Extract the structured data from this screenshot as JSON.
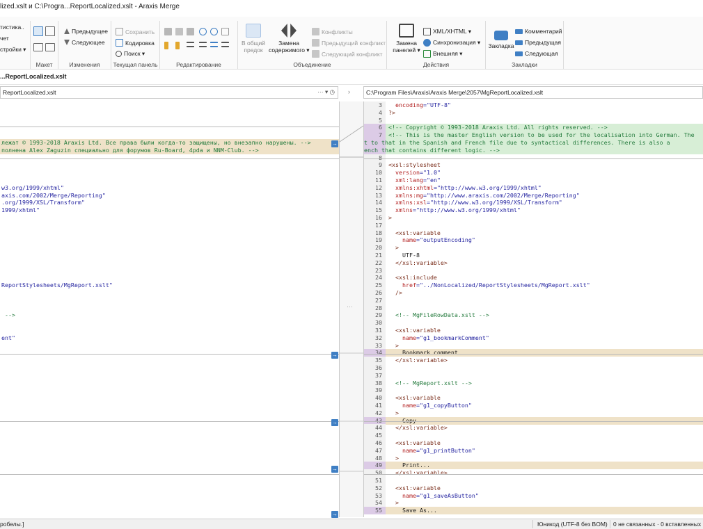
{
  "window": {
    "title": "lized.xslt и C:\\Progra...ReportLocalized.xslt - Araxis Merge"
  },
  "ribbon": {
    "stats": [
      "тистика..",
      "чет",
      "стройки ▾"
    ],
    "layout": {
      "label": "Макет"
    },
    "changes": {
      "prev": "Предыдущее",
      "next": "Следующее",
      "label": "Изменения"
    },
    "current_panel": {
      "save": "Сохранить",
      "encoding": "Кодировка",
      "search": "Поиск ▾",
      "label": "Текущая панель"
    },
    "editing": {
      "label": "Редактирование"
    },
    "merge": {
      "general_view": "В общий\nпредок",
      "replace": "Замена\nсодержимого ▾",
      "conflicts": "Конфликты",
      "prev_conflict": "Предыдущий конфликт",
      "next_conflict": "Следующий конфликт",
      "label": "Объединение"
    },
    "actions": {
      "replace_panels": "Замена\nпанелей ▾",
      "xml": "XML/XHTML ▾",
      "sync": "Синхронизация ▾",
      "external": "Внешняя ▾",
      "label": "Действия"
    },
    "bookmarks": {
      "bookmark": "Закладка",
      "comment": "Комментарий",
      "prev": "Предыдущая",
      "next": "Следующая",
      "label": "Закладки"
    }
  },
  "doc_tab": {
    "label": "...ReportLocalized.xslt"
  },
  "path_left": {
    "text": "ReportLocalized.xslt",
    "tools": "··· ▾ ◷"
  },
  "path_right": {
    "text": "C:\\Program Files\\Araxis\\Araxis Merge\\2057\\MgReportLocalized.xslt"
  },
  "left_lines": [
    {
      "row": 5,
      "text": "лежат © 1993-2018 Araxis Ltd. Все права были когда-то защищены, но внезапно нарушены. -->",
      "cls": "cmt",
      "bg": "chg"
    },
    {
      "row": 6,
      "text": "полнена Alex Zaguzin специально для форумов Ru-Board, 4pda и NNM-Club. -->",
      "cls": "cmt",
      "bg": "chg"
    },
    {
      "row": 11,
      "text": "w3.org/1999/xhtml\"",
      "cls": "val",
      "bg": ""
    },
    {
      "row": 12,
      "text": "axis.com/2002/Merge/Reporting\"",
      "cls": "val",
      "bg": ""
    },
    {
      "row": 13,
      "text": ".org/1999/XSL/Transform\"",
      "cls": "val",
      "bg": ""
    },
    {
      "row": 14,
      "text": "1999/xhtml\"",
      "cls": "val",
      "bg": ""
    },
    {
      "row": 24,
      "text": "ReportStylesheets/MgReport.xslt\"",
      "cls": "val",
      "bg": ""
    },
    {
      "row": 28,
      "text": " -->",
      "cls": "cmt",
      "bg": ""
    },
    {
      "row": 31,
      "text": "ent\"",
      "cls": "val",
      "bg": ""
    }
  ],
  "right_lines": [
    {
      "n": "3",
      "parts": [
        {
          "t": "  ",
          "c": ""
        },
        {
          "t": "encoding",
          "c": "attr"
        },
        {
          "t": "=\"UTF-8\"",
          "c": "val"
        }
      ],
      "bg": ""
    },
    {
      "n": "4",
      "parts": [
        {
          "t": "?>",
          "c": "tag"
        }
      ],
      "bg": ""
    },
    {
      "n": "5",
      "parts": [],
      "bg": ""
    },
    {
      "n": "6",
      "parts": [
        {
          "t": "<!-- Copyright © 1993-2018 Araxis Ltd. All rights reserved. -->",
          "c": "cmt"
        }
      ],
      "bg": "ins"
    },
    {
      "n": "7",
      "parts": [
        {
          "t": "<!-- This is the master English version to be used for the localisation into German. The",
          "c": "cmt"
        }
      ],
      "bg": "ins"
    },
    {
      "n": "",
      "parts": [
        {
          "t": "t to that in the Spanish and French file due to syntactical differences. There is also a",
          "c": "cmt"
        }
      ],
      "bg": "ins",
      "lc": true
    },
    {
      "n": "",
      "parts": [
        {
          "t": "ench that contains different logic. -->",
          "c": "cmt"
        }
      ],
      "bg": "ins",
      "lc": true
    },
    {
      "n": "8",
      "parts": [],
      "bg": ""
    },
    {
      "n": "9",
      "parts": [
        {
          "t": "<xsl:stylesheet",
          "c": "tag"
        }
      ],
      "bg": ""
    },
    {
      "n": "10",
      "parts": [
        {
          "t": "  ",
          "c": ""
        },
        {
          "t": "version",
          "c": "attr"
        },
        {
          "t": "=\"1.0\"",
          "c": "val"
        }
      ],
      "bg": ""
    },
    {
      "n": "11",
      "parts": [
        {
          "t": "  ",
          "c": ""
        },
        {
          "t": "xml:lang",
          "c": "attr"
        },
        {
          "t": "=\"en\"",
          "c": "val"
        }
      ],
      "bg": ""
    },
    {
      "n": "12",
      "parts": [
        {
          "t": "  ",
          "c": ""
        },
        {
          "t": "xmlns:xhtml",
          "c": "attr"
        },
        {
          "t": "=\"http://www.w3.org/1999/xhtml\"",
          "c": "val"
        }
      ],
      "bg": ""
    },
    {
      "n": "13",
      "parts": [
        {
          "t": "  ",
          "c": ""
        },
        {
          "t": "xmlns:mg",
          "c": "attr"
        },
        {
          "t": "=\"http://www.araxis.com/2002/Merge/Reporting\"",
          "c": "val"
        }
      ],
      "bg": ""
    },
    {
      "n": "14",
      "parts": [
        {
          "t": "  ",
          "c": ""
        },
        {
          "t": "xmlns:xsl",
          "c": "attr"
        },
        {
          "t": "=\"http://www.w3.org/1999/XSL/Transform\"",
          "c": "val"
        }
      ],
      "bg": ""
    },
    {
      "n": "15",
      "parts": [
        {
          "t": "  ",
          "c": ""
        },
        {
          "t": "xmlns",
          "c": "attr"
        },
        {
          "t": "=\"http://www.w3.org/1999/xhtml\"",
          "c": "val"
        }
      ],
      "bg": ""
    },
    {
      "n": "16",
      "parts": [
        {
          "t": ">",
          "c": "tag"
        }
      ],
      "bg": ""
    },
    {
      "n": "17",
      "parts": [],
      "bg": ""
    },
    {
      "n": "18",
      "parts": [
        {
          "t": "  <xsl:variable",
          "c": "tag"
        }
      ],
      "bg": ""
    },
    {
      "n": "19",
      "parts": [
        {
          "t": "    ",
          "c": ""
        },
        {
          "t": "name",
          "c": "attr"
        },
        {
          "t": "=\"outputEncoding\"",
          "c": "val"
        }
      ],
      "bg": ""
    },
    {
      "n": "20",
      "parts": [
        {
          "t": "  >",
          "c": "tag"
        }
      ],
      "bg": ""
    },
    {
      "n": "21",
      "parts": [
        {
          "t": "    UTF-8",
          "c": ""
        }
      ],
      "bg": ""
    },
    {
      "n": "22",
      "parts": [
        {
          "t": "  </xsl:variable>",
          "c": "tag"
        }
      ],
      "bg": ""
    },
    {
      "n": "23",
      "parts": [],
      "bg": ""
    },
    {
      "n": "24",
      "parts": [
        {
          "t": "  <xsl:include",
          "c": "tag"
        }
      ],
      "bg": ""
    },
    {
      "n": "25",
      "parts": [
        {
          "t": "    ",
          "c": ""
        },
        {
          "t": "href",
          "c": "attr"
        },
        {
          "t": "=\"../NonLocalized/ReportStylesheets/MgReport.xslt\"",
          "c": "val"
        }
      ],
      "bg": ""
    },
    {
      "n": "26",
      "parts": [
        {
          "t": "  />",
          "c": "tag"
        }
      ],
      "bg": ""
    },
    {
      "n": "27",
      "parts": [],
      "bg": ""
    },
    {
      "n": "28",
      "parts": [],
      "bg": ""
    },
    {
      "n": "29",
      "parts": [
        {
          "t": "  <!-- MgFileRowData.xslt -->",
          "c": "cmt"
        }
      ],
      "bg": ""
    },
    {
      "n": "30",
      "parts": [],
      "bg": ""
    },
    {
      "n": "31",
      "parts": [
        {
          "t": "  <xsl:variable",
          "c": "tag"
        }
      ],
      "bg": ""
    },
    {
      "n": "32",
      "parts": [
        {
          "t": "    ",
          "c": ""
        },
        {
          "t": "name",
          "c": "attr"
        },
        {
          "t": "=\"g1_bookmarkComment\"",
          "c": "val"
        }
      ],
      "bg": ""
    },
    {
      "n": "33",
      "parts": [
        {
          "t": "  >",
          "c": "tag"
        }
      ],
      "bg": ""
    },
    {
      "n": "34",
      "parts": [
        {
          "t": "    Bookmark comment",
          "c": ""
        }
      ],
      "bg": "chg"
    },
    {
      "n": "35",
      "parts": [
        {
          "t": "  </xsl:variable>",
          "c": "tag"
        }
      ],
      "bg": ""
    },
    {
      "n": "36",
      "parts": [],
      "bg": ""
    },
    {
      "n": "37",
      "parts": [],
      "bg": ""
    },
    {
      "n": "38",
      "parts": [
        {
          "t": "  <!-- MgReport.xslt -->",
          "c": "cmt"
        }
      ],
      "bg": ""
    },
    {
      "n": "39",
      "parts": [],
      "bg": ""
    },
    {
      "n": "40",
      "parts": [
        {
          "t": "  <xsl:variable",
          "c": "tag"
        }
      ],
      "bg": ""
    },
    {
      "n": "41",
      "parts": [
        {
          "t": "    ",
          "c": ""
        },
        {
          "t": "name",
          "c": "attr"
        },
        {
          "t": "=\"g1_copyButton\"",
          "c": "val"
        }
      ],
      "bg": ""
    },
    {
      "n": "42",
      "parts": [
        {
          "t": "  >",
          "c": "tag"
        }
      ],
      "bg": ""
    },
    {
      "n": "43",
      "parts": [
        {
          "t": "    Copy",
          "c": ""
        }
      ],
      "bg": "chg"
    },
    {
      "n": "44",
      "parts": [
        {
          "t": "  </xsl:variable>",
          "c": "tag"
        }
      ],
      "bg": ""
    },
    {
      "n": "45",
      "parts": [],
      "bg": ""
    },
    {
      "n": "46",
      "parts": [
        {
          "t": "  <xsl:variable",
          "c": "tag"
        }
      ],
      "bg": ""
    },
    {
      "n": "47",
      "parts": [
        {
          "t": "    ",
          "c": ""
        },
        {
          "t": "name",
          "c": "attr"
        },
        {
          "t": "=\"g1_printButton\"",
          "c": "val"
        }
      ],
      "bg": ""
    },
    {
      "n": "48",
      "parts": [
        {
          "t": "  >",
          "c": "tag"
        }
      ],
      "bg": ""
    },
    {
      "n": "49",
      "parts": [
        {
          "t": "    Print...",
          "c": ""
        }
      ],
      "bg": "chg"
    },
    {
      "n": "50",
      "parts": [
        {
          "t": "  </xsl:variable>",
          "c": "tag"
        }
      ],
      "bg": ""
    },
    {
      "n": "51",
      "parts": [],
      "bg": ""
    },
    {
      "n": "52",
      "parts": [
        {
          "t": "  <xsl:variable",
          "c": "tag"
        }
      ],
      "bg": ""
    },
    {
      "n": "53",
      "parts": [
        {
          "t": "    ",
          "c": ""
        },
        {
          "t": "name",
          "c": "attr"
        },
        {
          "t": "=\"g1_saveAsButton\"",
          "c": "val"
        }
      ],
      "bg": ""
    },
    {
      "n": "54",
      "parts": [
        {
          "t": "  >",
          "c": "tag"
        }
      ],
      "bg": ""
    },
    {
      "n": "55",
      "parts": [
        {
          "t": "    Save As...",
          "c": ""
        }
      ],
      "bg": "chg"
    }
  ],
  "status": {
    "left": "робелы.]",
    "encoding": "Юникод (UTF-8 без BOM)",
    "stats": "0 не связанных · 0 вставленных ·"
  },
  "colors": {
    "accent": "#3f7fc4",
    "change": "#efe2c8",
    "insert": "#d7eed6",
    "gutter_mark": "#dccbe6"
  }
}
